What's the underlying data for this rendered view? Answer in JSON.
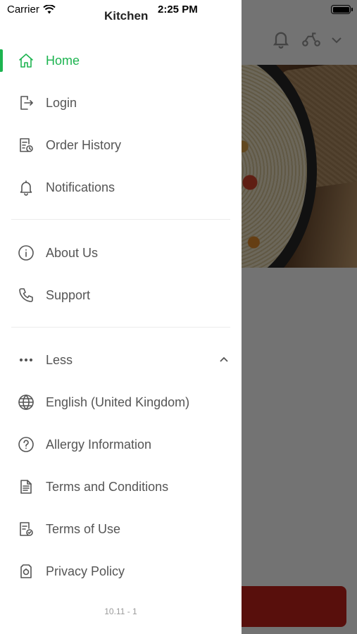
{
  "status_bar": {
    "carrier": "Carrier",
    "time": "2:25 PM"
  },
  "brand_peek": "Kitchen",
  "menu": {
    "primary": [
      {
        "label": "Home",
        "icon": "home-icon",
        "active": true
      },
      {
        "label": "Login",
        "icon": "login-icon"
      },
      {
        "label": "Order History",
        "icon": "order-history-icon"
      },
      {
        "label": "Notifications",
        "icon": "bell-icon"
      }
    ],
    "secondary": [
      {
        "label": "About Us",
        "icon": "info-icon"
      },
      {
        "label": "Support",
        "icon": "phone-icon"
      }
    ],
    "more_toggle": {
      "label": "Less",
      "icon": "more-dots-icon",
      "expanded": true
    },
    "extra": [
      {
        "label": "English (United Kingdom)",
        "icon": "globe-icon"
      },
      {
        "label": "Allergy Information",
        "icon": "question-icon"
      },
      {
        "label": "Terms and Conditions",
        "icon": "document-icon"
      },
      {
        "label": "Terms of Use",
        "icon": "document-check-icon"
      },
      {
        "label": "Privacy Policy",
        "icon": "privacy-icon"
      }
    ]
  },
  "version": "10.11 - 1",
  "colors": {
    "accent": "#1db450",
    "text": "#555555",
    "overlay": "#6e6e6e",
    "brand_button": "#c4231c"
  }
}
